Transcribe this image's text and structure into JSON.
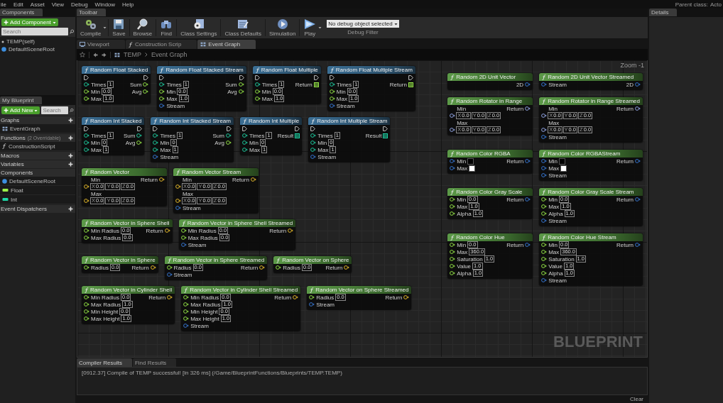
{
  "menu": [
    "ile",
    "Edit",
    "Asset",
    "View",
    "Debug",
    "Window",
    "Help"
  ],
  "parent_class": {
    "label": "Parent class:",
    "value": "Acto"
  },
  "components_panel": {
    "tab": "Components",
    "add_button": "Add Component",
    "search": {
      "placeholder": "Search"
    },
    "items": [
      {
        "label": "TEMP(self)",
        "kind": "self"
      },
      {
        "label": "DefaultSceneRoot",
        "kind": "component"
      }
    ]
  },
  "my_blueprint": {
    "tab": "My Blueprint",
    "add_button": "Add New",
    "search": {
      "placeholder": "Search"
    },
    "sections": [
      {
        "title": "Graphs",
        "add": true,
        "items": [
          {
            "label": "EventGraph",
            "kind": "graph"
          }
        ]
      },
      {
        "title": "Functions",
        "note": "(2 Overridable)",
        "add": true,
        "items": [
          {
            "label": "ConstructionScript",
            "kind": "function"
          }
        ]
      },
      {
        "title": "Macros",
        "add": true
      },
      {
        "title": "Variables",
        "add": true
      },
      {
        "title": "Components",
        "add": false,
        "items": [
          {
            "label": "DefaultSceneRoot",
            "kind": "component"
          },
          {
            "label": "Float",
            "kind": "float"
          },
          {
            "label": "Int",
            "kind": "int"
          }
        ]
      },
      {
        "title": "Event Dispatchers",
        "add": true
      }
    ]
  },
  "toolbar": {
    "tab": "Toolbar",
    "buttons": [
      {
        "label": "Compile",
        "kind": "compile",
        "menu": true
      },
      {
        "label": "Save",
        "kind": "save",
        "menu": false
      },
      {
        "label": "Browse",
        "kind": "browse",
        "menu": false
      },
      {
        "label": "Find",
        "kind": "find",
        "menu": false
      },
      {
        "label": "Class Settings",
        "kind": "settings",
        "menu": false
      },
      {
        "label": "Class Defaults",
        "kind": "defaults",
        "menu": false
      },
      {
        "label": "Simulation",
        "kind": "simulation",
        "menu": false
      },
      {
        "label": "Play",
        "kind": "play",
        "menu": true
      }
    ],
    "debug_filter": {
      "value": "No debug object selected",
      "label": "Debug Filter"
    }
  },
  "doc_tabs": [
    {
      "label": "Viewport",
      "kind": "viewport",
      "selected": false
    },
    {
      "label": "Construction Scrip",
      "kind": "function",
      "selected": false
    },
    {
      "label": "Event Graph",
      "kind": "graph",
      "selected": true
    }
  ],
  "breadcrumb": [
    "TEMP",
    "Event Graph"
  ],
  "zoom": "Zoom -1",
  "graph_label": "BLUEPRINT",
  "nodes": [
    {
      "title": "Random Float Stacked",
      "kind": "impure",
      "exec": true,
      "inputs": [
        {
          "label": "Times",
          "kind": "int",
          "value": "1"
        },
        {
          "label": "Min",
          "kind": "float",
          "value": "0.0"
        },
        {
          "label": "Max",
          "kind": "float",
          "value": "1.0"
        }
      ],
      "outputs": [
        {
          "label": "Sum",
          "kind": "float"
        },
        {
          "label": "Avg",
          "kind": "float"
        }
      ]
    },
    {
      "title": "Random Float Stacked Stream",
      "kind": "impure",
      "exec": true,
      "inputs": [
        {
          "label": "Times",
          "kind": "int",
          "value": "1"
        },
        {
          "label": "Min",
          "kind": "float",
          "value": "0.0"
        },
        {
          "label": "Max",
          "kind": "float",
          "value": "1.0"
        },
        {
          "label": "Stream",
          "kind": "struct"
        }
      ],
      "outputs": [
        {
          "label": "Sum",
          "kind": "float"
        },
        {
          "label": "Avg",
          "kind": "float"
        }
      ]
    },
    {
      "title": "Random Float Multiple",
      "kind": "impure",
      "exec": true,
      "inputs": [
        {
          "label": "Times",
          "kind": "int",
          "value": "1"
        },
        {
          "label": "Min",
          "kind": "float",
          "value": "0.0"
        },
        {
          "label": "Max",
          "kind": "float",
          "value": "1.0"
        }
      ],
      "outputs": [
        {
          "label": "Return",
          "kind": "float",
          "array": true
        }
      ]
    },
    {
      "title": "Random Float Multiple Stream",
      "kind": "impure",
      "exec": true,
      "inputs": [
        {
          "label": "Times",
          "kind": "int",
          "value": "1"
        },
        {
          "label": "Min",
          "kind": "float",
          "value": "0.0"
        },
        {
          "label": "Max",
          "kind": "float",
          "value": "1.0"
        },
        {
          "label": "Stream",
          "kind": "struct"
        }
      ],
      "outputs": [
        {
          "label": "Return",
          "kind": "float",
          "array": true
        }
      ]
    },
    {
      "title": "Random Int Stacked",
      "kind": "impure",
      "exec": true,
      "inputs": [
        {
          "label": "Times",
          "kind": "int",
          "value": "1"
        },
        {
          "label": "Min",
          "kind": "int",
          "value": "0"
        },
        {
          "label": "Max",
          "kind": "int",
          "value": "1"
        }
      ],
      "outputs": [
        {
          "label": "Sum",
          "kind": "int"
        },
        {
          "label": "Avg",
          "kind": "float"
        }
      ]
    },
    {
      "title": "Random Int Stacked Stream",
      "kind": "impure",
      "exec": true,
      "inputs": [
        {
          "label": "Times",
          "kind": "int",
          "value": "1"
        },
        {
          "label": "Min",
          "kind": "int",
          "value": "0"
        },
        {
          "label": "Max",
          "kind": "int",
          "value": "1"
        },
        {
          "label": "Stream",
          "kind": "struct"
        }
      ],
      "outputs": [
        {
          "label": "Sum",
          "kind": "int"
        },
        {
          "label": "Avg",
          "kind": "float"
        }
      ]
    },
    {
      "title": "Random Int Multiple",
      "kind": "impure",
      "exec": true,
      "inputs": [
        {
          "label": "Times",
          "kind": "int",
          "value": "1"
        },
        {
          "label": "Min",
          "kind": "int",
          "value": "0"
        },
        {
          "label": "Max",
          "kind": "int",
          "value": "1"
        }
      ],
      "outputs": [
        {
          "label": "Result",
          "kind": "int",
          "array": true
        }
      ]
    },
    {
      "title": "Random Int Multiple Stream",
      "kind": "impure",
      "exec": true,
      "inputs": [
        {
          "label": "Times",
          "kind": "int",
          "value": "1"
        },
        {
          "label": "Min",
          "kind": "int",
          "value": "0"
        },
        {
          "label": "Max",
          "kind": "int",
          "value": "1"
        },
        {
          "label": "Stream",
          "kind": "struct"
        }
      ],
      "outputs": [
        {
          "label": "Result",
          "kind": "int",
          "array": true
        }
      ]
    },
    {
      "title": "Random Vector",
      "kind": "pure",
      "exec": false,
      "inputs": [
        {
          "label": "Min",
          "kind": "vector",
          "values": [
            {
              "axis": "X",
              "value": "0.0"
            },
            {
              "axis": "Y",
              "value": "0.0"
            },
            {
              "axis": "Z",
              "value": "0.0"
            }
          ]
        },
        {
          "label": "Max",
          "kind": "vector",
          "values": [
            {
              "axis": "X",
              "value": "0.0"
            },
            {
              "axis": "Y",
              "value": "0.0"
            },
            {
              "axis": "Z",
              "value": "0.0"
            }
          ]
        }
      ],
      "outputs": [
        {
          "label": "Return",
          "kind": "vector"
        }
      ]
    },
    {
      "title": "Random Vector Stream",
      "kind": "pure",
      "exec": false,
      "inputs": [
        {
          "label": "Min",
          "kind": "vector",
          "values": [
            {
              "axis": "X",
              "value": "0.0"
            },
            {
              "axis": "Y",
              "value": "0.0"
            },
            {
              "axis": "Z",
              "value": "0.0"
            }
          ]
        },
        {
          "label": "Max",
          "kind": "vector",
          "values": [
            {
              "axis": "X",
              "value": "0.0"
            },
            {
              "axis": "Y",
              "value": "0.0"
            },
            {
              "axis": "Z",
              "value": "0.0"
            }
          ]
        },
        {
          "label": "Stream",
          "kind": "struct"
        }
      ],
      "outputs": [
        {
          "label": "Return",
          "kind": "vector"
        }
      ]
    },
    {
      "title": "Random Vector in Sphere Shell",
      "kind": "pure",
      "exec": false,
      "inputs": [
        {
          "label": "Min Radius",
          "kind": "float",
          "value": "0.0"
        },
        {
          "label": "Max Radius",
          "kind": "float",
          "value": "0.0"
        }
      ],
      "outputs": [
        {
          "label": "Return",
          "kind": "vector"
        }
      ]
    },
    {
      "title": "Random Vector in Sphere Shell Streamed",
      "kind": "pure",
      "exec": false,
      "inputs": [
        {
          "label": "Min Radius",
          "kind": "float",
          "value": "0.0"
        },
        {
          "label": "Max Radius",
          "kind": "float",
          "value": "0.0"
        },
        {
          "label": "Stream",
          "kind": "struct"
        }
      ],
      "outputs": [
        {
          "label": "Return",
          "kind": "vector"
        }
      ]
    },
    {
      "title": "Random Vector in Sphere",
      "kind": "pure",
      "exec": false,
      "inputs": [
        {
          "label": "Radius",
          "kind": "float",
          "value": "0.0"
        }
      ],
      "outputs": [
        {
          "label": "Return",
          "kind": "vector"
        }
      ]
    },
    {
      "title": "Random Vector in Sphere Streamed",
      "kind": "pure",
      "exec": false,
      "inputs": [
        {
          "label": "Radius",
          "kind": "float",
          "value": "0.0"
        },
        {
          "label": "Stream",
          "kind": "struct"
        }
      ],
      "outputs": [
        {
          "label": "Return",
          "kind": "vector"
        }
      ]
    },
    {
      "title": "Random Vector on Sphere",
      "kind": "pure",
      "exec": false,
      "inputs": [
        {
          "label": "Radius",
          "kind": "float",
          "value": "0.0"
        }
      ],
      "outputs": [
        {
          "label": "Return",
          "kind": "vector"
        }
      ]
    },
    {
      "title": "Random Vector in Cylinder Shell",
      "kind": "pure",
      "exec": false,
      "inputs": [
        {
          "label": "Min Radius",
          "kind": "float",
          "value": "0.0"
        },
        {
          "label": "Max Radius",
          "kind": "float",
          "value": "1.0"
        },
        {
          "label": "Min Height",
          "kind": "float",
          "value": "0.0"
        },
        {
          "label": "Max Height",
          "kind": "float",
          "value": "1.0"
        }
      ],
      "outputs": [
        {
          "label": "Return",
          "kind": "vector"
        }
      ]
    },
    {
      "title": "Random Vector in Cylinder Shell Streamed",
      "kind": "pure",
      "exec": false,
      "inputs": [
        {
          "label": "Min Radius",
          "kind": "float",
          "value": "0.0"
        },
        {
          "label": "Max Radius",
          "kind": "float",
          "value": "1.0"
        },
        {
          "label": "Min Height",
          "kind": "float",
          "value": "0.0"
        },
        {
          "label": "Max Height",
          "kind": "float",
          "value": "1.0"
        },
        {
          "label": "Stream",
          "kind": "struct"
        }
      ],
      "outputs": [
        {
          "label": "Return",
          "kind": "vector"
        }
      ]
    },
    {
      "title": "Random Vector on Sphere Streamed",
      "kind": "pure",
      "exec": false,
      "inputs": [
        {
          "label": "Radius",
          "kind": "float",
          "value": "0.0"
        },
        {
          "label": "Stream",
          "kind": "struct"
        }
      ],
      "outputs": [
        {
          "label": "Return",
          "kind": "vector"
        }
      ]
    },
    {
      "title": "Random 2D Unit Vector",
      "kind": "pure",
      "exec": false,
      "outputs": [
        {
          "label": "2D",
          "kind": "struct"
        }
      ]
    },
    {
      "title": "Random 2D Unit Vector Streamed",
      "kind": "pure",
      "exec": false,
      "inputs": [
        {
          "label": "Stream",
          "kind": "struct"
        }
      ],
      "outputs": [
        {
          "label": "2D",
          "kind": "struct"
        }
      ]
    },
    {
      "title": "Random Rotator in Range",
      "kind": "pure",
      "exec": false,
      "inputs": [
        {
          "label": "Min",
          "kind": "rotator",
          "values": [
            {
              "axis": "X",
              "value": "0.0"
            },
            {
              "axis": "Y",
              "value": "0.0"
            },
            {
              "axis": "Z",
              "value": "0.0"
            }
          ]
        },
        {
          "label": "Max",
          "kind": "rotator",
          "values": [
            {
              "axis": "X",
              "value": "0.0"
            },
            {
              "axis": "Y",
              "value": "0.0"
            },
            {
              "axis": "Z",
              "value": "0.0"
            }
          ]
        }
      ],
      "outputs": [
        {
          "label": "Return",
          "kind": "rotator"
        }
      ]
    },
    {
      "title": "Random Rotator in Range Streamed",
      "kind": "pure",
      "exec": false,
      "inputs": [
        {
          "label": "Min",
          "kind": "rotator",
          "values": [
            {
              "axis": "X",
              "value": "0.0"
            },
            {
              "axis": "Y",
              "value": "0.0"
            },
            {
              "axis": "Z",
              "value": "0.0"
            }
          ]
        },
        {
          "label": "Max",
          "kind": "rotator",
          "values": [
            {
              "axis": "X",
              "value": "0.0"
            },
            {
              "axis": "Y",
              "value": "0.0"
            },
            {
              "axis": "Z",
              "value": "0.0"
            }
          ]
        },
        {
          "label": "Stream",
          "kind": "struct"
        }
      ],
      "outputs": [
        {
          "label": "Return",
          "kind": "rotator"
        }
      ]
    },
    {
      "title": "Random Color RGBA",
      "kind": "pure",
      "exec": false,
      "inputs": [
        {
          "label": "Min",
          "kind": "struct",
          "color": "#000000"
        },
        {
          "label": "Max",
          "kind": "struct",
          "color": "#ffffff"
        }
      ],
      "outputs": [
        {
          "label": "Return",
          "kind": "struct"
        }
      ]
    },
    {
      "title": "Random Color RGBAStream",
      "kind": "pure",
      "exec": false,
      "inputs": [
        {
          "label": "Min",
          "kind": "struct",
          "color": "#000000"
        },
        {
          "label": "Max",
          "kind": "struct",
          "color": "#ffffff"
        },
        {
          "label": "Stream",
          "kind": "struct"
        }
      ],
      "outputs": [
        {
          "label": "Return",
          "kind": "struct"
        }
      ]
    },
    {
      "title": "Random Color Gray Scale",
      "kind": "pure",
      "exec": false,
      "inputs": [
        {
          "label": "Min",
          "kind": "float",
          "value": "0.0"
        },
        {
          "label": "Max",
          "kind": "float",
          "value": "1.0"
        },
        {
          "label": "Alpha",
          "kind": "float",
          "value": "1.0"
        }
      ],
      "outputs": [
        {
          "label": "Return",
          "kind": "struct"
        }
      ]
    },
    {
      "title": "Random Color Gray Scale Stream",
      "kind": "pure",
      "exec": false,
      "inputs": [
        {
          "label": "Min",
          "kind": "float",
          "value": "0.0"
        },
        {
          "label": "Max",
          "kind": "float",
          "value": "1.0"
        },
        {
          "label": "Alpha",
          "kind": "float",
          "value": "1.0"
        },
        {
          "label": "Stream",
          "kind": "struct"
        }
      ],
      "outputs": [
        {
          "label": "Return",
          "kind": "struct"
        }
      ]
    },
    {
      "title": "Random Color Hue",
      "kind": "pure",
      "exec": false,
      "inputs": [
        {
          "label": "Min",
          "kind": "float",
          "value": "0.0"
        },
        {
          "label": "Max",
          "kind": "float",
          "value": "360.0"
        },
        {
          "label": "Saturation",
          "kind": "float",
          "value": "1.0"
        },
        {
          "label": "Value",
          "kind": "float",
          "value": "1.0"
        },
        {
          "label": "Alpha",
          "kind": "float",
          "value": "1.0"
        }
      ],
      "outputs": [
        {
          "label": "Return",
          "kind": "struct"
        }
      ]
    },
    {
      "title": "Random Color Hue Stream",
      "kind": "pure",
      "exec": false,
      "inputs": [
        {
          "label": "Min",
          "kind": "float",
          "value": "0.0"
        },
        {
          "label": "Max",
          "kind": "float",
          "value": "360.0"
        },
        {
          "label": "Saturation",
          "kind": "float",
          "value": "1.0"
        },
        {
          "label": "Value",
          "kind": "float",
          "value": "1.0"
        },
        {
          "label": "Alpha",
          "kind": "float",
          "value": "1.0"
        },
        {
          "label": "Stream",
          "kind": "struct"
        }
      ],
      "outputs": [
        {
          "label": "Return",
          "kind": "struct"
        }
      ]
    }
  ],
  "details": {
    "tab": "Details"
  },
  "results": {
    "tabs": [
      {
        "label": "Compiler Results",
        "selected": true
      },
      {
        "label": "Find Results",
        "selected": false
      }
    ],
    "log": [
      "[0912.37] Compile of TEMP successful! [in 326 ms] (/Game/BlueprintFunctions/Blueprints/TEMP.TEMP)"
    ],
    "clear_button": "Clear"
  }
}
